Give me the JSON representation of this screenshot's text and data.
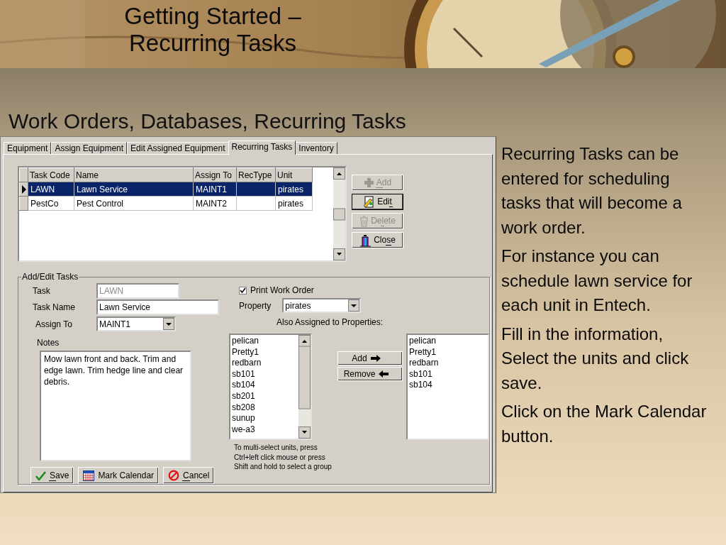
{
  "slide": {
    "title_lines": [
      "Getting Started –",
      "Recurring Tasks"
    ],
    "subtitle": "Work Orders, Databases, Recurring Tasks",
    "notes": [
      "Recurring Tasks can be entered for scheduling tasks that will become a work order.",
      "For instance you can schedule lawn service for each unit in Entech.",
      "Fill in the information, Select the units and click save.",
      "Click on the Mark Calendar button."
    ]
  },
  "window": {
    "tabs": [
      {
        "label": "Equipment",
        "selected": false
      },
      {
        "label": "Assign Equipment",
        "selected": false
      },
      {
        "label": "Edit Assigned Equipment",
        "selected": false
      },
      {
        "label": "Recurring Tasks",
        "selected": true
      },
      {
        "label": "Inventory",
        "selected": false
      }
    ],
    "grid": {
      "columns": [
        "Task Code",
        "Name",
        "Assign To",
        "RecType",
        "Unit"
      ],
      "rows": [
        {
          "cells": [
            "LAWN",
            "Lawn Service",
            "MAINT1",
            "",
            "pirates"
          ],
          "selected": true
        },
        {
          "cells": [
            "PestCo",
            "Pest Control",
            "MAINT2",
            "",
            "pirates"
          ],
          "selected": false
        }
      ]
    },
    "actions": [
      {
        "kind": "add",
        "label": [
          {
            "text": "A",
            "underlined": true
          },
          {
            "text": "dd",
            "underlined": false
          }
        ],
        "disabled": true,
        "default": false
      },
      {
        "kind": "edit",
        "label": [
          {
            "text": "Edi",
            "underlined": false
          },
          {
            "text": "t",
            "underlined": true
          }
        ],
        "disabled": false,
        "default": true
      },
      {
        "kind": "delete",
        "label": [
          {
            "text": "De",
            "underlined": false
          },
          {
            "text": "l",
            "underlined": true
          },
          {
            "text": "ete",
            "underlined": false
          }
        ],
        "disabled": true,
        "default": false
      },
      {
        "kind": "close",
        "label": [
          {
            "text": "Clo",
            "underlined": false
          },
          {
            "text": "s",
            "underlined": true
          },
          {
            "text": "e",
            "underlined": false
          }
        ],
        "disabled": false,
        "default": false
      }
    ],
    "form": {
      "title": "Add/Edit Tasks",
      "task": {
        "label": "Task",
        "value": "LAWN",
        "disabled": true
      },
      "task_name": {
        "label": "Task Name",
        "value": "Lawn Service"
      },
      "assign_to": {
        "label": "Assign To",
        "value": "MAINT1"
      },
      "notes": {
        "label": "Notes",
        "value": "Mow lawn front and back. Trim and edge lawn. Trim hedge line and clear debris."
      },
      "print_work_order": {
        "label": "Print Work Order",
        "checked": true
      },
      "property": {
        "label": "Property",
        "value": "pirates"
      },
      "also_assigned_label": "Also Assigned to Properties:",
      "available": [
        "pelican",
        "Pretty1",
        "redbarn",
        "sb101",
        "sb104",
        "sb201",
        "sb208",
        "sunup",
        "we-a3"
      ],
      "assigned": [
        "pelican",
        "Pretty1",
        "redbarn",
        "sb101",
        "sb104"
      ],
      "move_buttons": [
        {
          "kind": "add",
          "label": "Add"
        },
        {
          "kind": "remove",
          "label": "Remove"
        }
      ],
      "hint": "To multi-select units, press Ctrl+left click mouse or press Shift and hold to select a group",
      "buttons": [
        {
          "kind": "save",
          "label": [
            {
              "text": "S",
              "underlined": true
            },
            {
              "text": "ave",
              "underlined": false
            }
          ]
        },
        {
          "kind": "calendar",
          "label": [
            {
              "text": "Mark Calendar",
              "underlined": false
            }
          ]
        },
        {
          "kind": "cancel",
          "label": [
            {
              "text": "C",
              "underlined": true
            },
            {
              "text": "ancel",
              "underlined": false
            }
          ]
        }
      ]
    }
  }
}
